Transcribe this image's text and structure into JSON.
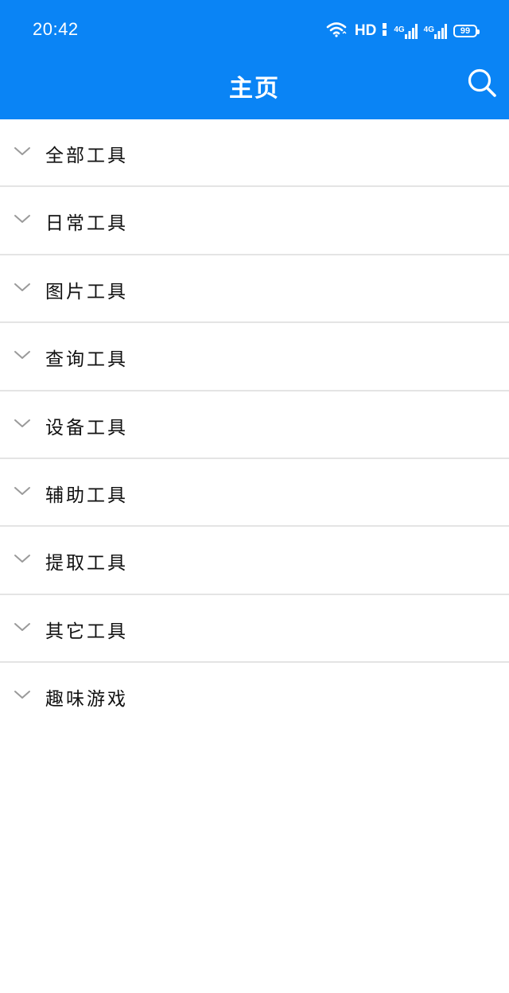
{
  "status_bar": {
    "time": "20:42",
    "network_label": "HD",
    "sim1_label": "4G",
    "sim2_label": "4G",
    "battery": "99"
  },
  "app_bar": {
    "title": "主页",
    "search_icon": "search-icon"
  },
  "colors": {
    "primary": "#0a84f5",
    "divider": "#e4e4e4",
    "chevron": "#9a9a9a",
    "text": "#111111"
  },
  "categories": [
    {
      "label": "全部工具",
      "icon": "chevron-down-icon"
    },
    {
      "label": "日常工具",
      "icon": "chevron-down-icon"
    },
    {
      "label": "图片工具",
      "icon": "chevron-down-icon"
    },
    {
      "label": "查询工具",
      "icon": "chevron-down-icon"
    },
    {
      "label": "设备工具",
      "icon": "chevron-down-icon"
    },
    {
      "label": "辅助工具",
      "icon": "chevron-down-icon"
    },
    {
      "label": "提取工具",
      "icon": "chevron-down-icon"
    },
    {
      "label": "其它工具",
      "icon": "chevron-down-icon"
    },
    {
      "label": "趣味游戏",
      "icon": "chevron-down-icon"
    }
  ]
}
